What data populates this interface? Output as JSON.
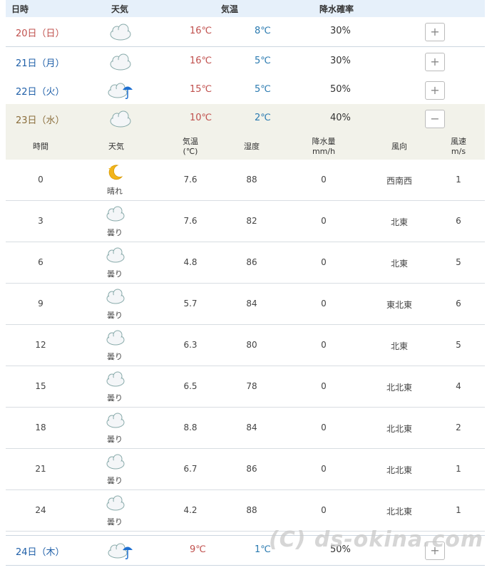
{
  "header": {
    "date_label": "日時",
    "weather_label": "天気",
    "temp_label": "気温",
    "pop_label": "降水確率"
  },
  "days": [
    {
      "date": "20日（日）",
      "icon": "cloud-icon",
      "hi": "16℃",
      "lo": "8℃",
      "pop": "30%",
      "toggle": "+"
    },
    {
      "date": "21日（月）",
      "icon": "cloud-icon",
      "hi": "16℃",
      "lo": "5℃",
      "pop": "30%",
      "toggle": "+"
    },
    {
      "date": "22日（火）",
      "icon": "cloud-umbrella-icon",
      "hi": "15℃",
      "lo": "5℃",
      "pop": "50%",
      "toggle": "+"
    },
    {
      "date": "23日（水）",
      "icon": "cloud-icon",
      "hi": "10℃",
      "lo": "2℃",
      "pop": "40%",
      "toggle": "−"
    },
    {
      "date": "24日（木）",
      "icon": "cloud-umbrella-icon",
      "hi": "9℃",
      "lo": "1℃",
      "pop": "50%",
      "toggle": "+"
    }
  ],
  "hourly_header": {
    "time": "時間",
    "weather": "天気",
    "temp_line1": "気温",
    "temp_line2": "(℃)",
    "humidity": "湿度",
    "precip_line1": "降水量",
    "precip_line2": "mm/h",
    "wind_dir": "風向",
    "wind_speed_line1": "風速",
    "wind_speed_line2": "m/s"
  },
  "hourly": [
    {
      "time": "0",
      "icon": "moon-star-icon",
      "weather": "晴れ",
      "temp": "7.6",
      "humidity": "88",
      "precip": "0",
      "wind_dir": "西南西",
      "wind_speed": "1"
    },
    {
      "time": "3",
      "icon": "cloud-icon",
      "weather": "曇り",
      "temp": "7.6",
      "humidity": "82",
      "precip": "0",
      "wind_dir": "北東",
      "wind_speed": "6"
    },
    {
      "time": "6",
      "icon": "cloud-icon",
      "weather": "曇り",
      "temp": "4.8",
      "humidity": "86",
      "precip": "0",
      "wind_dir": "北東",
      "wind_speed": "5"
    },
    {
      "time": "9",
      "icon": "cloud-icon",
      "weather": "曇り",
      "temp": "5.7",
      "humidity": "84",
      "precip": "0",
      "wind_dir": "東北東",
      "wind_speed": "6"
    },
    {
      "time": "12",
      "icon": "cloud-icon",
      "weather": "曇り",
      "temp": "6.3",
      "humidity": "80",
      "precip": "0",
      "wind_dir": "北東",
      "wind_speed": "5"
    },
    {
      "time": "15",
      "icon": "cloud-icon",
      "weather": "曇り",
      "temp": "6.5",
      "humidity": "78",
      "precip": "0",
      "wind_dir": "北北東",
      "wind_speed": "4"
    },
    {
      "time": "18",
      "icon": "cloud-icon",
      "weather": "曇り",
      "temp": "8.8",
      "humidity": "84",
      "precip": "0",
      "wind_dir": "北北東",
      "wind_speed": "2"
    },
    {
      "time": "21",
      "icon": "cloud-icon",
      "weather": "曇り",
      "temp": "6.7",
      "humidity": "86",
      "precip": "0",
      "wind_dir": "北北東",
      "wind_speed": "1"
    },
    {
      "time": "24",
      "icon": "cloud-icon",
      "weather": "曇り",
      "temp": "4.2",
      "humidity": "88",
      "precip": "0",
      "wind_dir": "北北東",
      "wind_speed": "1"
    }
  ],
  "watermark": "(C) ds-okina.com",
  "colors": {
    "hi": "#c0504d",
    "lo": "#2a7ab0",
    "header_bg": "#e6f0fa",
    "expanded_bg": "#f2f2ea"
  }
}
